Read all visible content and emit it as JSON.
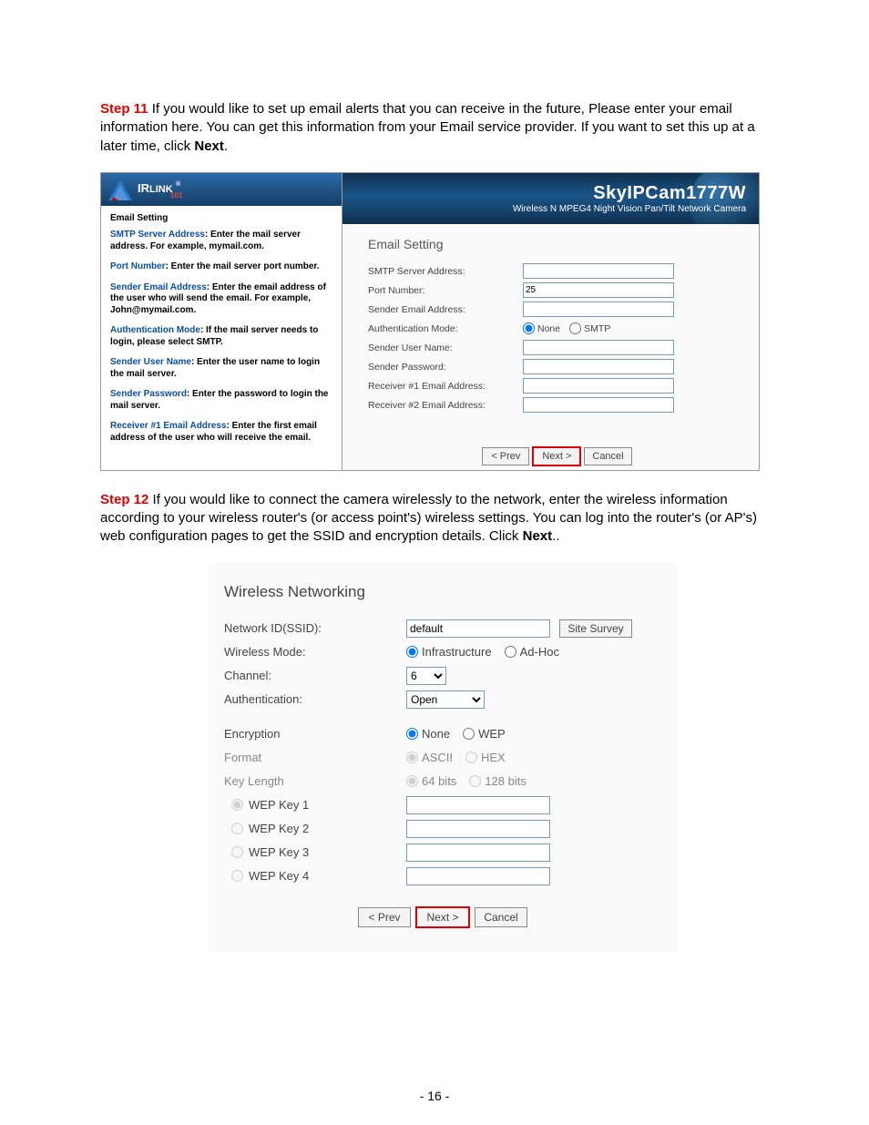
{
  "step11": {
    "label": "Step 11",
    "text_a": " If you would like to set up email alerts that you can receive in the future, Please enter your email information here.  You can get this information from your Email service provider.  If you want to set this up at a later time, click ",
    "bold": "Next",
    "text_b": "."
  },
  "shot1": {
    "brand_a": "IR",
    "brand_b": "LINK",
    "brand_sup": "®",
    "brand_sub": "101",
    "title": "SkyIPCam1777W",
    "subtitle": "Wireless N MPEG4 Night Vision Pan/Tilt Network Camera",
    "side": {
      "header": "Email Setting",
      "items": [
        {
          "term": "SMTP Server Address",
          "desc": ": Enter the mail server address. For example, mymail.com."
        },
        {
          "term": "Port Number",
          "desc": ": Enter the mail server port number."
        },
        {
          "term": "Sender Email Address",
          "desc": ": Enter the email address of the user who will send the email. For example, John@mymail.com."
        },
        {
          "term": "Authentication Mode",
          "desc": ": If the mail server needs to login, please select SMTP."
        },
        {
          "term": "Sender User Name",
          "desc": ": Enter the user name to login the mail server."
        },
        {
          "term": "Sender Password",
          "desc": ": Enter the password to login the mail server."
        },
        {
          "term": "Receiver #1 Email Address",
          "desc": ": Enter the first email address of the user who will receive the email."
        }
      ]
    },
    "form": {
      "heading": "Email Setting",
      "smtp_lbl": "SMTP Server Address:",
      "smtp_val": "",
      "port_lbl": "Port Number:",
      "port_val": "25",
      "sender_lbl": "Sender Email Address:",
      "sender_val": "",
      "auth_lbl": "Authentication Mode:",
      "auth_none": "None",
      "auth_smtp": "SMTP",
      "user_lbl": "Sender User Name:",
      "user_val": "",
      "pass_lbl": "Sender Password:",
      "pass_val": "",
      "r1_lbl": "Receiver #1 Email Address:",
      "r1_val": "",
      "r2_lbl": "Receiver #2 Email Address:",
      "r2_val": ""
    },
    "nav": {
      "prev": "< Prev",
      "next": "Next >",
      "cancel": "Cancel"
    }
  },
  "step12": {
    "label": "Step 12",
    "text_a": " If you would like to connect the camera wirelessly to the network, enter the wireless information according to your wireless router's (or access point's) wireless settings. You can log into the router's (or AP's) web configuration pages to get the SSID and encryption details. Click ",
    "bold": "Next",
    "text_b": ".."
  },
  "shot2": {
    "heading": "Wireless Networking",
    "ssid_lbl": "Network ID(SSID):",
    "ssid_val": "default",
    "survey": "Site Survey",
    "mode_lbl": "Wireless Mode:",
    "mode_infra": "Infrastructure",
    "mode_adhoc": "Ad-Hoc",
    "channel_lbl": "Channel:",
    "channel_val": "6",
    "auth_lbl": "Authentication:",
    "auth_val": "Open",
    "enc_lbl": "Encryption",
    "enc_none": "None",
    "enc_wep": "WEP",
    "fmt_lbl": "Format",
    "fmt_ascii": "ASCII",
    "fmt_hex": "HEX",
    "klen_lbl": "Key Length",
    "klen_64": "64 bits",
    "klen_128": "128 bits",
    "k1_lbl": "WEP Key 1",
    "k1_val": "",
    "k2_lbl": "WEP Key 2",
    "k2_val": "",
    "k3_lbl": "WEP Key 3",
    "k3_val": "",
    "k4_lbl": "WEP Key 4",
    "k4_val": "",
    "nav": {
      "prev": "< Prev",
      "next": "Next >",
      "cancel": "Cancel"
    }
  },
  "page_number": "- 16 -"
}
